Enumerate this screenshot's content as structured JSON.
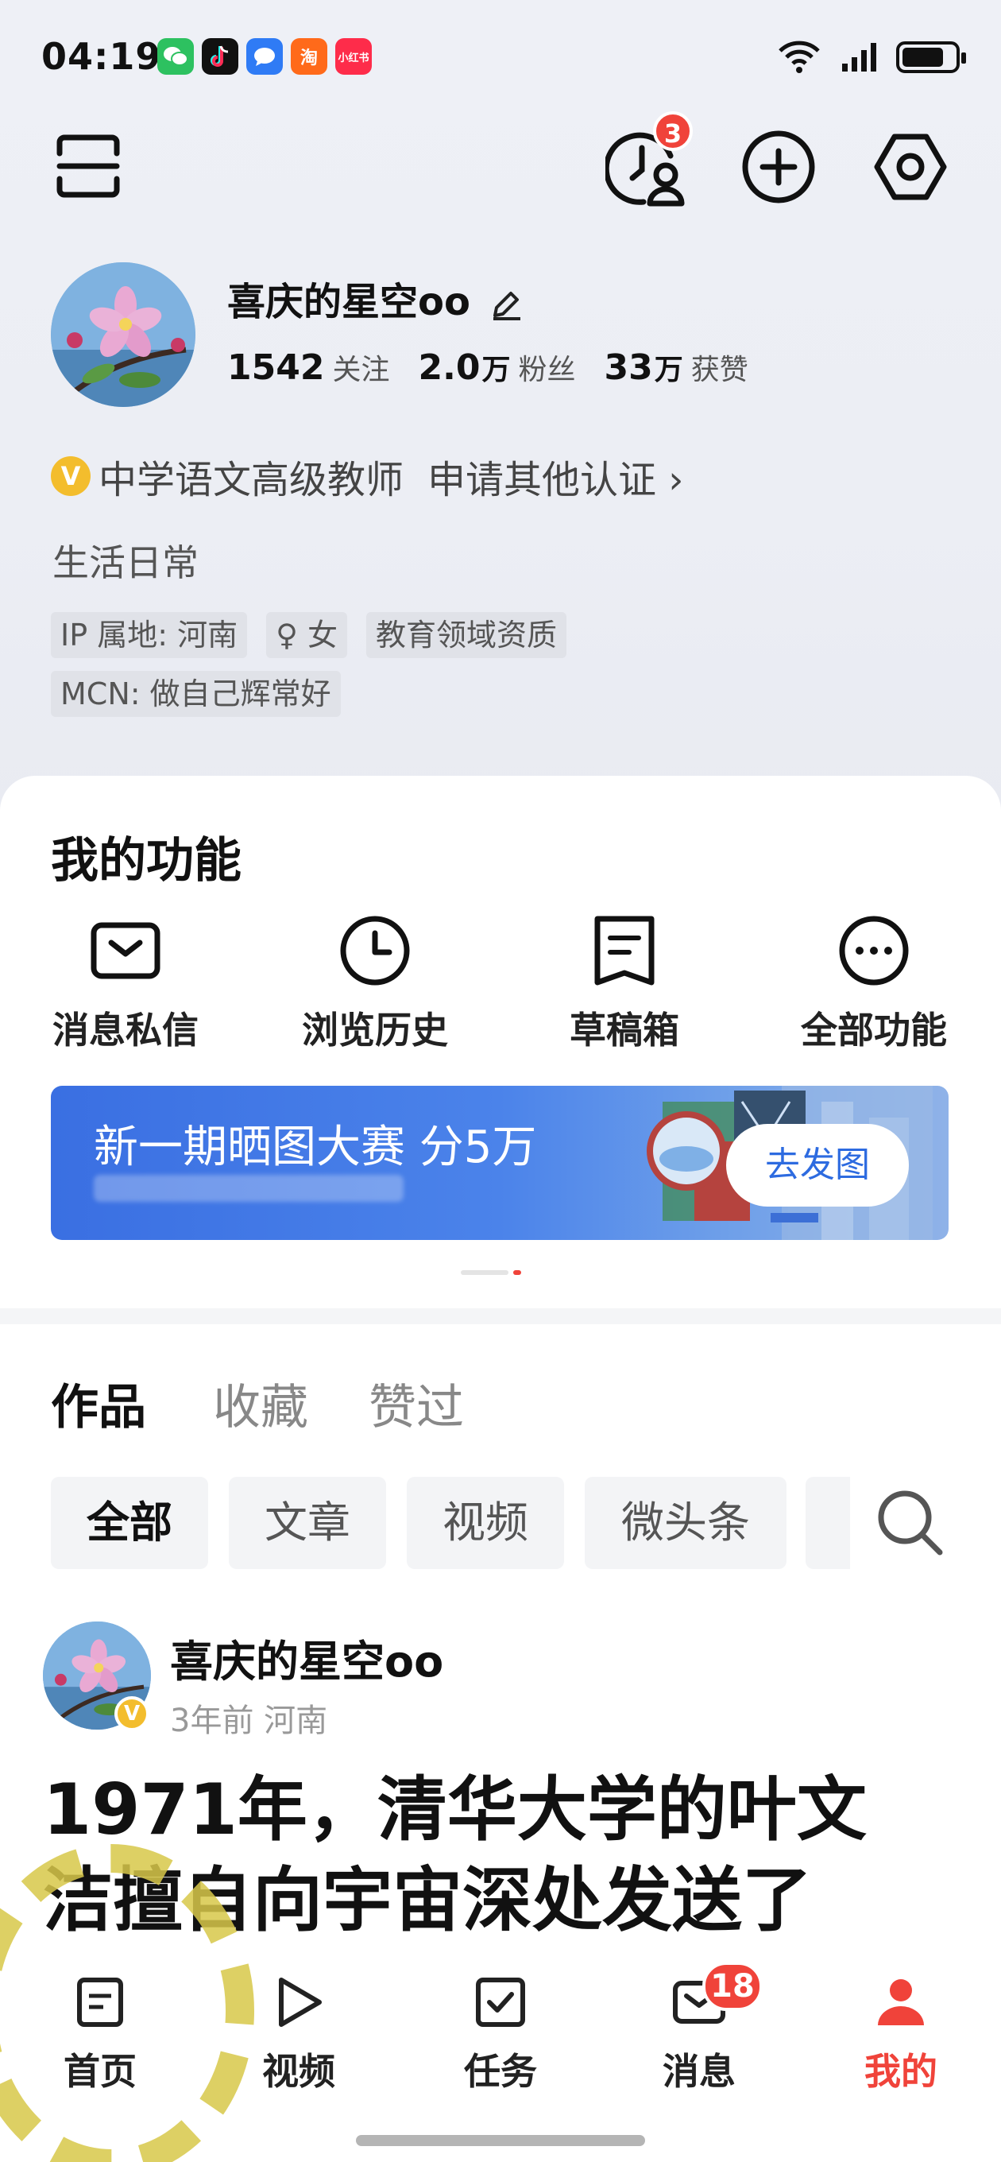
{
  "status_bar": {
    "time": "04:19",
    "apps": [
      "wechat",
      "douyin",
      "messages",
      "taobao",
      "xiaohongshu"
    ],
    "taobao_glyph": "淘",
    "xhs_label": "小红书",
    "battery_percent": 80
  },
  "header": {
    "notification_count": "3"
  },
  "profile": {
    "username": "喜庆的星空oo",
    "following_num": "1542",
    "following_label": "关注",
    "fans_num": "2.0",
    "fans_unit": "万",
    "fans_label": "粉丝",
    "likes_num": "33",
    "likes_unit": "万",
    "likes_label": "获赞",
    "verify_badge": "V",
    "verify_text": "中学语文高级教师",
    "verify_more": "申请其他认证 ›",
    "bio": "生活日常",
    "tags": [
      "IP 属地: 河南",
      "♀ 女",
      "教育领域资质"
    ],
    "mcn": "MCN: 做自己辉常好"
  },
  "functions": {
    "title": "我的功能",
    "items": [
      {
        "label": "消息私信",
        "icon": "mail-icon"
      },
      {
        "label": "浏览历史",
        "icon": "clock-icon"
      },
      {
        "label": "草稿箱",
        "icon": "draft-icon"
      },
      {
        "label": "全部功能",
        "icon": "more-icon"
      }
    ],
    "banner_text": "新一期晒图大赛 分5万",
    "banner_button": "去发图"
  },
  "works": {
    "tabs": [
      "作品",
      "收藏",
      "赞过"
    ],
    "active_tab": "作品",
    "filters": [
      "全部",
      "文章",
      "视频",
      "微头条"
    ],
    "active_filter": "全部"
  },
  "post": {
    "author": "喜庆的星空oo",
    "meta": "3年前 河南",
    "title_line1": "1971年，清华大学的叶文",
    "title_line2": "洁擅自向宇宙深处发送了"
  },
  "bottom_nav": {
    "items": [
      {
        "label": "首页",
        "icon": "home-icon"
      },
      {
        "label": "视频",
        "icon": "video-icon"
      },
      {
        "label": "任务",
        "icon": "task-icon"
      },
      {
        "label": "消息",
        "icon": "message-icon"
      },
      {
        "label": "我的",
        "icon": "profile-icon"
      }
    ],
    "message_badge": "18",
    "active": "我的",
    "active_color": "#f0433a"
  }
}
